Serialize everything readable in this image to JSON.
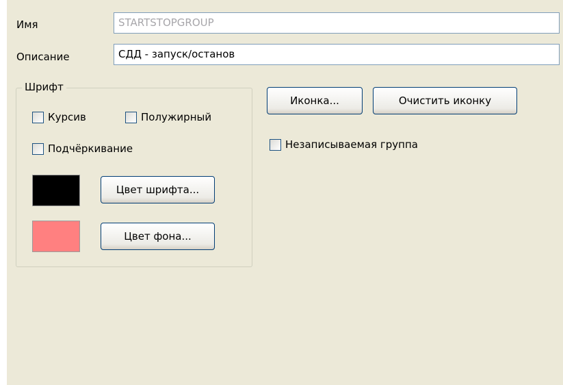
{
  "name_label": "Имя",
  "name_value": "STARTSTOPGROUP",
  "description_label": "Описание",
  "description_value": "СДД - запуск/останов",
  "font_group": {
    "title": "Шрифт",
    "italic_label": "Курсив",
    "bold_label": "Полужирный",
    "underline_label": "Подчёркивание",
    "italic_checked": false,
    "bold_checked": false,
    "underline_checked": false,
    "font_color_button": "Цвет шрифта...",
    "bg_color_button": "Цвет фона...",
    "font_color": "#000000",
    "bg_color": "#ff8080"
  },
  "icon_button": "Иконка...",
  "clear_icon_button": "Очистить иконку",
  "non_recordable_label": "Незаписываемая группа",
  "non_recordable_checked": false
}
